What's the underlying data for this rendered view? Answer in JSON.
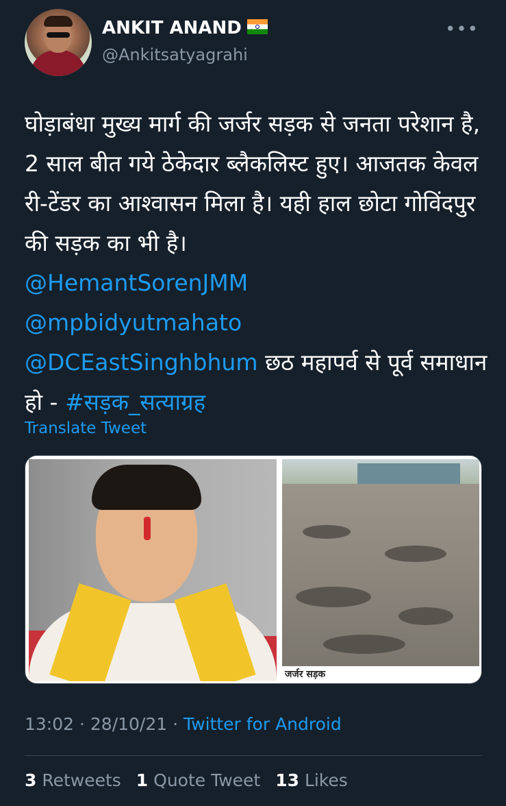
{
  "author": {
    "name": "ANKIT ANAND",
    "handle": "@Ankitsatyagrahi"
  },
  "menu": {
    "more_label": "•••"
  },
  "tweet": {
    "text_part1": "घोड़ाबंधा मुख्य मार्ग की जर्जर सड़क से जनता परेशान है, 2 साल बीत गये ठेकेदार ब्लैकलिस्ट हुए। आजतक केवल री-टेंडर का आश्वासन मिला है। यही हाल छोटा गोविंदपुर की सड़क का भी है।",
    "mention1": "@HemantSorenJMM",
    "mention2": "@mpbidyutmahato",
    "mention3": "@DCEastSinghbhum",
    "text_part2": " छठ महापर्व से पूर्व समाधान हो - ",
    "hashtag": "#सड़क_सत्याग्रह"
  },
  "translate_label": "Translate Tweet",
  "media": {
    "image2_caption": "जर्जर सड़क"
  },
  "meta": {
    "time": "13:02",
    "date": "28/10/21",
    "separator": " · ",
    "source": "Twitter for Android"
  },
  "stats": {
    "retweets_count": "3",
    "retweets_label": "Retweets",
    "quotes_count": "1",
    "quotes_label": "Quote Tweet",
    "likes_count": "13",
    "likes_label": "Likes"
  },
  "colors": {
    "background": "#15202b",
    "link": "#1d9bf0",
    "secondary_text": "#8b98a5"
  }
}
